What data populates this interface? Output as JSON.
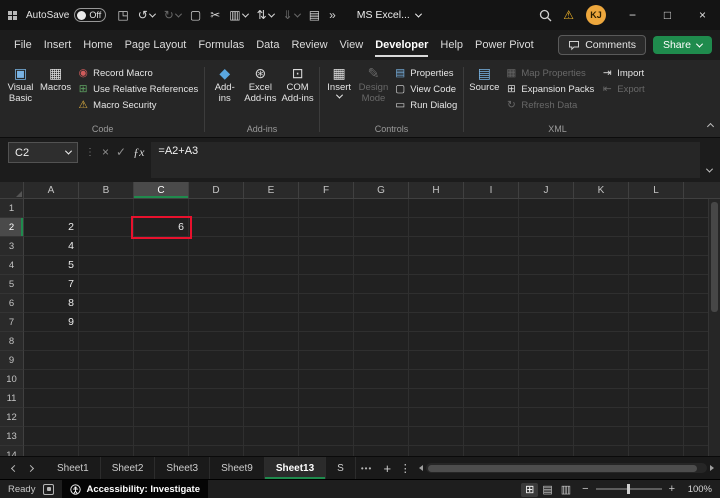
{
  "colors": {
    "accent_green": "#1f8b4d",
    "highlight_red": "#e8112d",
    "warning_yellow": "#f0b429",
    "avatar_orange": "#eda73d"
  },
  "titlebar": {
    "autosave_label": "AutoSave",
    "autosave_state": "Off",
    "app_title": "MS Excel...",
    "warning_glyph": "⚠",
    "avatar_initials": "KJ",
    "quick_access": [
      {
        "name": "save",
        "glyph": "◳"
      },
      {
        "name": "undo",
        "glyph": "↺",
        "dropdown": true
      },
      {
        "name": "redo",
        "glyph": "↻",
        "dropdown": true,
        "disabled": true
      },
      {
        "name": "copy",
        "glyph": "▢"
      },
      {
        "name": "cut",
        "glyph": "✂"
      },
      {
        "name": "paste",
        "glyph": "▥",
        "dropdown": true
      },
      {
        "name": "sort-filter",
        "glyph": "⇅",
        "dropdown": true
      },
      {
        "name": "fill",
        "glyph": "⇓",
        "dropdown": true,
        "disabled": true
      },
      {
        "name": "new-document",
        "glyph": "▤"
      },
      {
        "name": "more-commands",
        "glyph": "»"
      }
    ],
    "window_controls": [
      {
        "name": "minimize",
        "glyph": "−"
      },
      {
        "name": "maximize",
        "glyph": "□"
      },
      {
        "name": "close",
        "glyph": "×"
      }
    ]
  },
  "menu": {
    "tabs": [
      "File",
      "Insert",
      "Home",
      "Page Layout",
      "Formulas",
      "Data",
      "Review",
      "View",
      "Developer",
      "Help",
      "Power Pivot"
    ],
    "active": "Developer",
    "comments_label": "Comments",
    "share_label": "Share"
  },
  "ribbon": {
    "groups": [
      {
        "label": "Code",
        "big": [
          {
            "name": "visual-basic",
            "label_lines": [
              "Visual",
              "Basic"
            ],
            "glyph": "▣",
            "color": "#79b3e3"
          },
          {
            "name": "macros",
            "label_lines": [
              "Macros"
            ],
            "glyph": "▦",
            "color": "#d9d9d9"
          }
        ],
        "small_cols": [
          [
            {
              "name": "record-macro",
              "label": "Record Macro",
              "glyph": "◉",
              "color": "#cf5b5b"
            },
            {
              "name": "use-relative-references",
              "label": "Use Relative References",
              "glyph": "⊞",
              "color": "#5fa463"
            },
            {
              "name": "macro-security",
              "label": "Macro Security",
              "glyph": "⚠",
              "color": "#e3b341"
            }
          ]
        ]
      },
      {
        "label": "Add-ins",
        "big": [
          {
            "name": "add-ins",
            "label_lines": [
              "Add-",
              "ins"
            ],
            "glyph": "◆",
            "color": "#5aa7e0"
          },
          {
            "name": "excel-add-ins",
            "label_lines": [
              "Excel",
              "Add-ins"
            ],
            "glyph": "⊛",
            "color": "#d9d9d9"
          },
          {
            "name": "com-add-ins",
            "label_lines": [
              "COM",
              "Add-ins"
            ],
            "glyph": "⊡",
            "color": "#d9d9d9"
          }
        ],
        "small_cols": []
      },
      {
        "label": "Controls",
        "big": [
          {
            "name": "insert-control",
            "label_lines": [
              "Insert"
            ],
            "glyph": "▦",
            "color": "#d9d9d9",
            "dropdown": true
          },
          {
            "name": "design-mode",
            "label_lines": [
              "Design",
              "Mode"
            ],
            "glyph": "✎",
            "disabled": true
          }
        ],
        "small_cols": [
          [
            {
              "name": "properties",
              "label": "Properties",
              "glyph": "▤",
              "color": "#79b3e3"
            },
            {
              "name": "view-code",
              "label": "View Code",
              "glyph": "▢",
              "color": "#d9d9d9"
            },
            {
              "name": "run-dialog",
              "label": "Run Dialog",
              "glyph": "▭",
              "color": "#d9d9d9"
            }
          ]
        ]
      },
      {
        "label": "XML",
        "big": [
          {
            "name": "source",
            "label_lines": [
              "Source"
            ],
            "glyph": "▤",
            "color": "#79b3e3"
          }
        ],
        "small_cols": [
          [
            {
              "name": "map-properties",
              "label": "Map Properties",
              "glyph": "▦",
              "disabled": true
            },
            {
              "name": "expansion-packs",
              "label": "Expansion Packs",
              "glyph": "⊞",
              "color": "#d9d9d9"
            },
            {
              "name": "refresh-data",
              "label": "Refresh Data",
              "glyph": "↻",
              "disabled": true
            }
          ],
          [
            {
              "name": "import",
              "label": "Import",
              "glyph": "⇥",
              "color": "#d9d9d9"
            },
            {
              "name": "export",
              "label": "Export",
              "glyph": "⇤",
              "disabled": true
            }
          ]
        ]
      }
    ]
  },
  "formula_bar": {
    "name_box": "C2",
    "dots_glyph": "⋮",
    "cancel_glyph": "×",
    "enter_glyph": "✓",
    "fx_glyph": "ƒx",
    "formula": "=A2+A3"
  },
  "grid": {
    "columns": [
      "A",
      "B",
      "C",
      "D",
      "E",
      "F",
      "G",
      "H",
      "I",
      "J",
      "K",
      "L"
    ],
    "row_count": 14,
    "selected_column": "C",
    "selected_row": 2,
    "highlight_cell": "C2",
    "cells": {
      "A2": "2",
      "A3": "4",
      "A4": "5",
      "A5": "7",
      "A6": "8",
      "A7": "9",
      "C2": "6"
    }
  },
  "sheet_bar": {
    "tabs": [
      "Sheet1",
      "Sheet2",
      "Sheet3",
      "Sheet9",
      "Sheet13",
      "S"
    ],
    "active": "Sheet13",
    "more_glyph": "•••",
    "add_glyph": "+",
    "menu_glyph": "⋮"
  },
  "status_bar": {
    "ready": "Ready",
    "accessibility": "Accessibility: Investigate",
    "view_icons": [
      {
        "name": "normal-view",
        "glyph": "⊞"
      },
      {
        "name": "page-layout-view",
        "glyph": "▤"
      },
      {
        "name": "page-break-view",
        "glyph": "▥"
      }
    ],
    "zoom_out_glyph": "−",
    "zoom_in_glyph": "+",
    "zoom": "100%"
  }
}
